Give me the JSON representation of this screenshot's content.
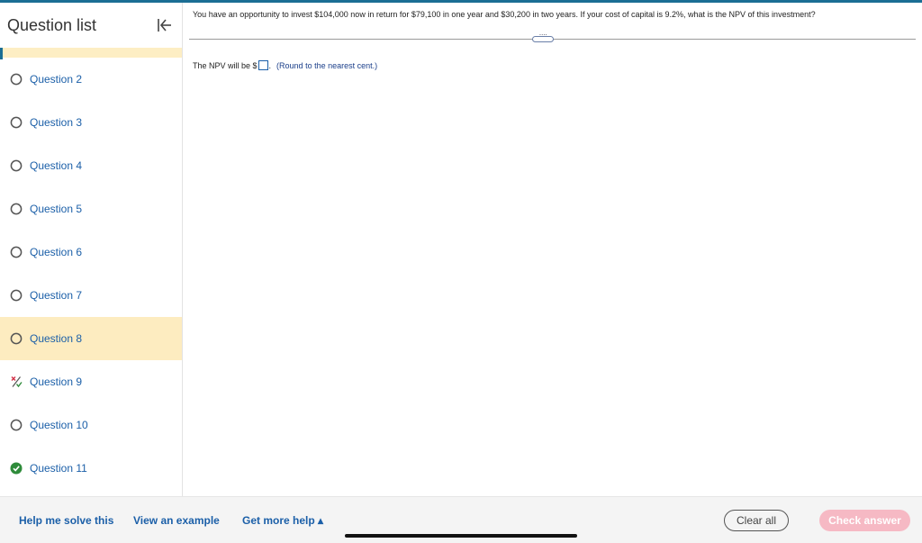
{
  "sidebar": {
    "title": "Question list",
    "items": [
      {
        "label": "Question 2",
        "status": "unanswered"
      },
      {
        "label": "Question 3",
        "status": "unanswered"
      },
      {
        "label": "Question 4",
        "status": "unanswered"
      },
      {
        "label": "Question 5",
        "status": "unanswered"
      },
      {
        "label": "Question 6",
        "status": "unanswered"
      },
      {
        "label": "Question 7",
        "status": "unanswered"
      },
      {
        "label": "Question 8",
        "status": "current"
      },
      {
        "label": "Question 9",
        "status": "partial"
      },
      {
        "label": "Question 10",
        "status": "unanswered"
      },
      {
        "label": "Question 11",
        "status": "correct"
      }
    ]
  },
  "question": {
    "text": "You have an opportunity to invest $104,000 now in return for $79,100 in one year and $30,200 in two years. If your cost of capital is 9.2%, what is the NPV of this investment?",
    "answer_prefix": "The NPV will be $",
    "answer_value": "",
    "answer_suffix": ".",
    "answer_note": "(Round to the nearest cent.)",
    "expand_label": "····"
  },
  "footer": {
    "help_solve": "Help me solve this",
    "view_example": "View an example",
    "more_help": "Get more help ▴",
    "clear_all": "Clear all",
    "check_answer": "Check answer"
  },
  "icons": {
    "collapse": "collapse-left-icon",
    "unanswered": "circle-outline-icon",
    "partial": "partial-credit-icon",
    "correct": "check-circle-icon"
  },
  "colors": {
    "accent": "#1b6e94",
    "link": "#1b5fa8",
    "active_highlight": "#fdecc0",
    "correct": "#2e8b3a",
    "check_button": "#f6b9c4"
  }
}
